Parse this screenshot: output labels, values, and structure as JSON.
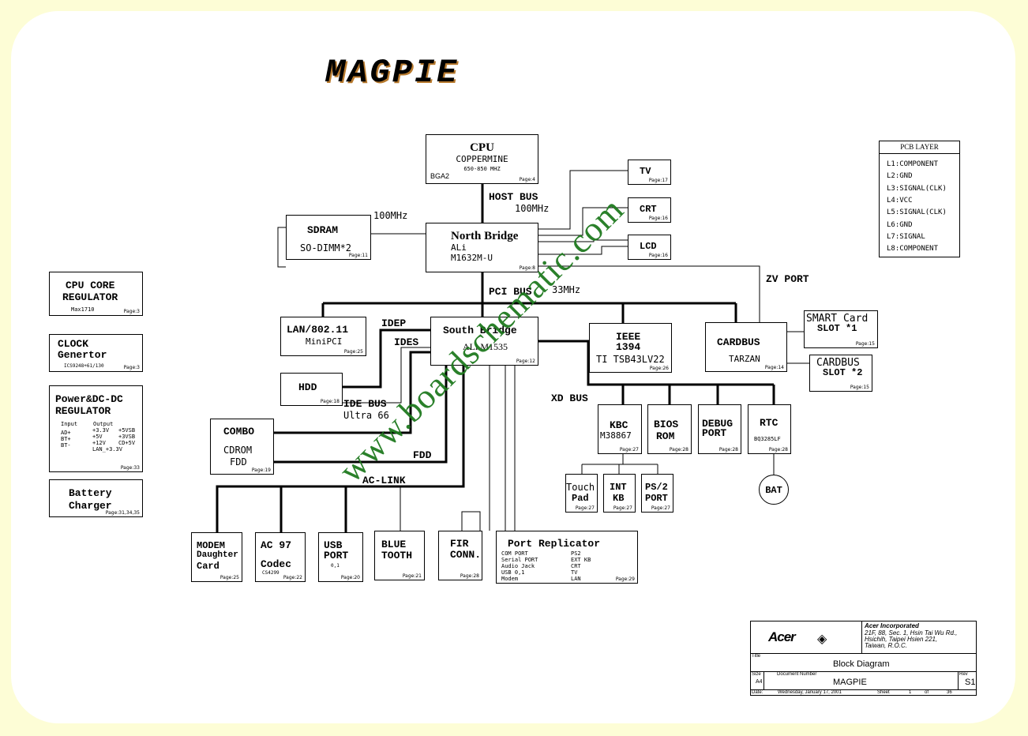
{
  "diagram_title": "MAGPIE",
  "watermark": "www.boardschematic.com",
  "pcb_layer": {
    "title": "PCB LAYER",
    "layers": [
      "L1:COMPONENT",
      "L2:GND",
      "L3:SIGNAL(CLK)",
      "L4:VCC",
      "L5:SIGNAL(CLK)",
      "L6:GND",
      "L7:SIGNAL",
      "L8:COMPONENT"
    ]
  },
  "blocks": {
    "cpu": {
      "title": "CPU",
      "sub": "COPPERMINE",
      "speed": "650-850 MHZ",
      "pkg": "BGA2",
      "page": "Page:4"
    },
    "north_bridge": {
      "title": "North Bridge",
      "vendor": "ALi",
      "part": "M1632M-U",
      "page": "Page:8"
    },
    "sdram": {
      "title": "SDRAM",
      "sub": "SO-DIMM*2",
      "page": "Page:11"
    },
    "tv": {
      "title": "TV",
      "page": "Page:17"
    },
    "crt": {
      "title": "CRT",
      "page": "Page:16"
    },
    "lcd": {
      "title": "LCD",
      "page": "Page:16"
    },
    "cpu_core_regulator": {
      "line1": "CPU CORE",
      "line2": "REGULATOR",
      "part": "Max1710",
      "page": "Page:3"
    },
    "clock": {
      "line1": "CLOCK",
      "line2": "Genertor",
      "part": "ICS9248+61/130",
      "page": "Page:3"
    },
    "power": {
      "line1": "Power&DC-DC",
      "line2": "REGULATOR",
      "input_hdr": "Input",
      "output_hdr": "Output",
      "inputs": [
        "AD+",
        "BT+",
        "BT-"
      ],
      "outputs1": [
        "+3.3V",
        "+5V",
        "+12V",
        "LAN_+3.3V"
      ],
      "outputs2": [
        "+5VSB",
        "+3VSB",
        "CD+5V"
      ],
      "page": "Page:33"
    },
    "battery_charger": {
      "line1": "Battery",
      "line2": "Charger",
      "page": "Page:31,34,35"
    },
    "lan": {
      "title": "LAN/802.11",
      "sub": "MiniPCI",
      "page": "Page:25"
    },
    "south_bridge": {
      "title": "South Bridge",
      "part": "ALi M1535",
      "page": "Page:12"
    },
    "ieee": {
      "line1": "IEEE",
      "line2": "1394",
      "part": "TI TSB43LV22",
      "page": "Page:26"
    },
    "cardbus": {
      "title": "CARDBUS",
      "part": "TARZAN",
      "page": "Page:14"
    },
    "smart_card": {
      "line1": "SMART Card",
      "line2": "SLOT *1",
      "page": "Page:15"
    },
    "cardbus_slot": {
      "line1": "CARDBUS",
      "line2": "SLOT *2",
      "page": "Page:15"
    },
    "hdd": {
      "title": "HDD",
      "page": "Page:18"
    },
    "combo": {
      "title": "COMBO",
      "line2": "CDROM",
      "line3": "FDD",
      "page": "Page:19"
    },
    "kbc": {
      "title": "KBC",
      "part": "M38867",
      "page": "Page:27"
    },
    "bios": {
      "line1": "BIOS",
      "line2": "ROM",
      "page": "Page:28"
    },
    "debug": {
      "line1": "DEBUG",
      "line2": "PORT",
      "page": "Page:28"
    },
    "rtc": {
      "title": "RTC",
      "part": "BQ3285LF",
      "page": "Page:28"
    },
    "bat": {
      "title": "BAT"
    },
    "touchpad": {
      "line1": "Touch",
      "line2": "Pad",
      "page": "Page:27"
    },
    "int_kb": {
      "line1": "INT",
      "line2": "KB",
      "page": "Page:27"
    },
    "ps2": {
      "line1": "PS/2",
      "line2": "PORT",
      "page": "Page:27"
    },
    "modem": {
      "line1": "MODEM",
      "line2": "Daughter",
      "line3": "Card",
      "page": "Page:25"
    },
    "ac97": {
      "line1": "AC 97",
      "line2": "Codec",
      "part": "CS4299",
      "page": "Page:22"
    },
    "usb": {
      "line1": "USB",
      "line2": "PORT",
      "sub": "0,1",
      "page": "Page:20"
    },
    "bluetooth": {
      "line1": "BLUE",
      "line2": "TOOTH",
      "page": "Page:21"
    },
    "fir": {
      "line1": "FIR",
      "line2": "CONN.",
      "page": "Page:28"
    },
    "port_replicator": {
      "title": "Port Replicator",
      "left": [
        "COM PORT",
        "Serial PORT",
        "Audio Jack",
        "USB 0,1",
        "Modem"
      ],
      "right": [
        "PS2",
        "EXT KB",
        "CRT",
        "TV",
        "LAN"
      ],
      "page": "Page:29"
    }
  },
  "bus_labels": {
    "host_bus": "HOST BUS",
    "host_speed": "100MHz",
    "sdram_speed": "100MHz",
    "pci_bus": "PCI BUS",
    "pci_speed": "33MHz",
    "zv_port": "ZV PORT",
    "idep": "IDEP",
    "ides": "IDES",
    "ide_bus": "IDE BUS",
    "ide_speed": "Ultra 66",
    "fdd": "FDD",
    "ac_link": "AC-LINK",
    "xd_bus": "XD BUS"
  },
  "title_block": {
    "company": "Acer Incorporated",
    "address": [
      "21F, 88, Sec. 1, Hsin Tai Wu Rd.,",
      "Hsichih, Taipei Hsien 221,",
      "Taiwan, R.O.C."
    ],
    "logo": "Acer",
    "title_label": "Title",
    "title": "Block Diagram",
    "size_label": "Size",
    "size": "A4",
    "docnum_label": "Document Number",
    "docnum": "MAGPIE",
    "rev_label": "Rev",
    "rev": "S1",
    "date_label": "Date:",
    "date": "Wednesday, January 17, 2001",
    "sheet_label": "Sheet",
    "sheet": "1",
    "of_label": "of",
    "total": "36"
  }
}
